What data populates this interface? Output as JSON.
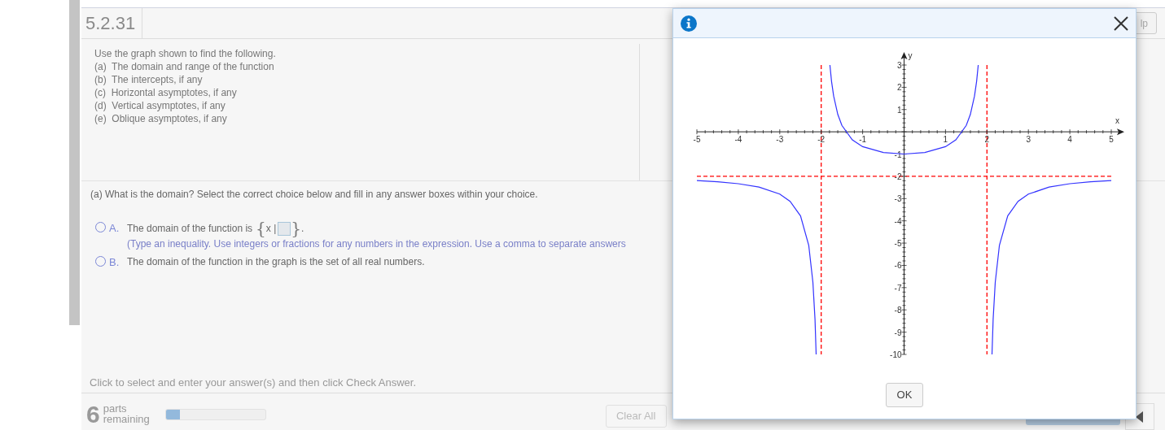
{
  "problem": {
    "number": "5.2.31",
    "help_button": "lp"
  },
  "instructions": [
    "Use the graph shown to find the following.",
    "(a)  The domain and range of the function",
    "(b)  The intercepts, if any",
    "(c)  Horizontal asymptotes, if any",
    "(d)  Vertical asymptotes, if any",
    "(e)  Oblique asymptotes, if any"
  ],
  "question": "(a)  What is the domain? Select the correct choice below and fill in any answer boxes within your choice.",
  "choices": [
    {
      "letter": "A.",
      "kind": "set",
      "lead": "The domain of the function is",
      "set_open": "{",
      "set_var": "x |",
      "set_close": "}",
      "set_end": ".",
      "hint": "(Type an inequality. Use integers or fractions for any numbers in the expression. Use a comma to separate answers",
      "selected": false
    },
    {
      "letter": "B.",
      "kind": "text",
      "lead": "The domain of the function in the graph is the set of all real numbers.",
      "selected": false
    }
  ],
  "footer_hint": "Click to select and enter your answer(s) and then click Check Answer.",
  "progress": {
    "count": "6",
    "label": "parts remaining",
    "level": 0.14
  },
  "clear_button": "Clear All",
  "dialog": {
    "ok_button": "OK",
    "chart_data": {
      "type": "line",
      "xlabel": "x",
      "ylabel": "y",
      "xlim": [
        -5,
        5
      ],
      "ylim": [
        -10,
        3
      ],
      "xticks": [
        -5,
        -4,
        -3,
        -2,
        -1,
        1,
        2,
        3,
        4,
        5
      ],
      "yticks": [
        3,
        2,
        1,
        -1,
        -2,
        -3,
        -4,
        -5,
        -6,
        -7,
        -8,
        -9,
        -10
      ],
      "x": [
        -5,
        -4.5,
        -4,
        -3.5,
        -3,
        -2.75,
        -2.5,
        -2.3,
        -2.2,
        -2.15,
        -2.1213,
        -2,
        -1.7889,
        -1.75,
        -1.7,
        -1.6,
        -1.5,
        -1.25,
        -1,
        -0.5,
        0,
        0.5,
        1,
        1.25,
        1.5,
        1.6,
        1.7,
        1.75,
        1.7889,
        2,
        2.1213,
        2.15,
        2.2,
        2.3,
        2.5,
        2.75,
        3,
        3.5,
        4,
        4.5,
        5
      ],
      "series": [
        {
          "color": "#3333ff",
          "values": [
            -2.19,
            -2.246,
            -2.333,
            -2.485,
            -2.8,
            -3.123,
            -3.778,
            -5.101,
            -6.762,
            -8.426,
            -10,
            null,
            3,
            2.267,
            1.604,
            0.778,
            0.286,
            -0.359,
            -0.667,
            -0.933,
            -1,
            -0.933,
            -0.667,
            -0.359,
            0.286,
            0.778,
            1.604,
            2.267,
            3,
            null,
            -10,
            -8.426,
            -6.762,
            -5.101,
            -3.778,
            -3.123,
            -2.8,
            -2.485,
            -2.333,
            -2.246,
            -2.19
          ]
        }
      ],
      "grid": false,
      "ref_lines": [
        {
          "axis": "x",
          "value": -2,
          "color": "#ff0000"
        },
        {
          "axis": "x",
          "value": 2,
          "color": "#ff0000"
        },
        {
          "axis": "y",
          "value": -2,
          "color": "#ff0000"
        }
      ]
    }
  }
}
